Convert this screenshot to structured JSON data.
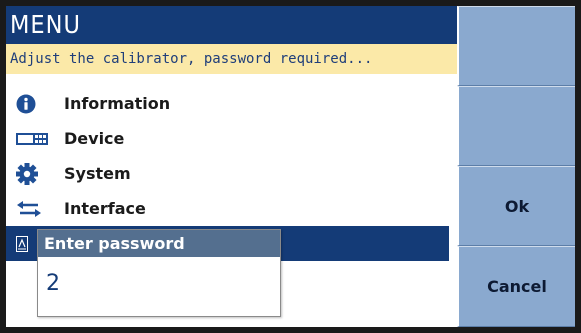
{
  "header": {
    "title": "MENU",
    "hint": "Adjust the calibrator, password required..."
  },
  "menu": {
    "items": [
      {
        "label": "Information",
        "icon": "info-icon"
      },
      {
        "label": "Device",
        "icon": "device-icon"
      },
      {
        "label": "System",
        "icon": "gear-icon"
      },
      {
        "label": "Interface",
        "icon": "arrows-icon"
      },
      {
        "label": "",
        "icon": "calibration-icon",
        "selected": true
      }
    ]
  },
  "password_dialog": {
    "title": "Enter password",
    "value": "2"
  },
  "softkeys": {
    "key1": "",
    "key2": "",
    "key3": "Ok",
    "key4": "Cancel"
  },
  "colors": {
    "title_bg": "#143b77",
    "hint_bg": "#fbe9a8",
    "softkey_bg": "#8aa9cf",
    "dialog_title_bg": "#546f8f"
  }
}
